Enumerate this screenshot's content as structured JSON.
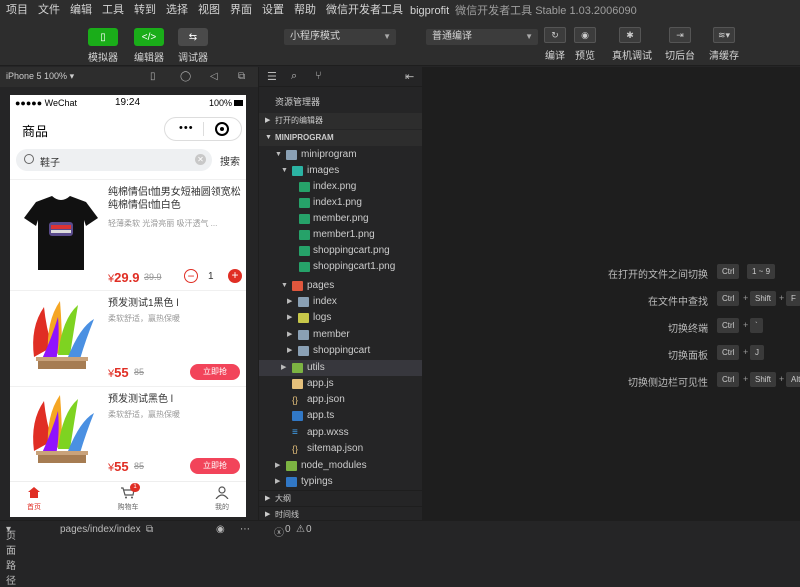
{
  "menubar": {
    "items": [
      "项目",
      "文件",
      "编辑",
      "工具",
      "转到",
      "选择",
      "视图",
      "界面",
      "设置",
      "帮助",
      "微信开发者工具"
    ],
    "project": "bigprofit",
    "app_title": "微信开发者工具 Stable 1.03.2006090"
  },
  "toolbar": {
    "simulator": "模拟器",
    "editor": "编辑器",
    "debugger": "调试器",
    "mode": "小程序模式",
    "compile": "普通编译",
    "compile_label": "编译",
    "preview": "预览",
    "real_debug": "真机调试",
    "background": "切后台",
    "clear_cache": "清缓存"
  },
  "simulator": {
    "device": "iPhone 5 100%",
    "status": {
      "carrier": "●●●●● WeChat",
      "time": "19:24",
      "battery": "100%"
    },
    "nav_title": "商品",
    "capsule_dots": "•••",
    "search_value": "鞋子",
    "search_button": "搜索",
    "products": [
      {
        "name": "纯棉情侣t恤男女短袖圆领宽松纯棉情侣t恤白色",
        "desc": "轻薄柔软 光滑亮丽 吸汗透气 ...",
        "currency": "¥",
        "price": "29.9",
        "orig": "39.9",
        "qty": "1"
      },
      {
        "name": "预发测试1黑色 l",
        "desc": "柔软舒适，赢热保暖",
        "currency": "¥",
        "price": "55",
        "orig": "85",
        "button": "立即抢"
      },
      {
        "name": "预发测试黑色 l",
        "desc": "柔软舒适，赢热保暖",
        "currency": "¥",
        "price": "55",
        "orig": "85",
        "button": "立即抢"
      }
    ],
    "tabs": {
      "home": "首页",
      "cart": "购物车",
      "cart_badge": "1",
      "mine": "我的"
    },
    "footer": {
      "path_label": "页面路径",
      "path": "pages/index/index"
    }
  },
  "explorer": {
    "title": "资源管理器",
    "open_editors": "打开的编辑器",
    "root": "MINIPROGRAM",
    "tree": {
      "miniprogram": "miniprogram",
      "images": "images",
      "img1": "index.png",
      "img2": "index1.png",
      "img3": "member.png",
      "img4": "member1.png",
      "img5": "shoppingcart.png",
      "img6": "shoppingcart1.png",
      "pages": "pages",
      "p_index": "index",
      "p_logs": "logs",
      "p_member": "member",
      "p_cart": "shoppingcart",
      "utils": "utils",
      "appjs": "app.js",
      "appjson": "app.json",
      "appts": "app.ts",
      "appwxss": "app.wxss",
      "sitemap": "sitemap.json",
      "node_modules": "node_modules",
      "typings": "typings"
    },
    "outline": "大纲",
    "timeline": "时间线",
    "problems": {
      "errors": "0",
      "warnings": "0"
    }
  },
  "editor": {
    "shortcuts": [
      {
        "label": "在打开的文件之间切换",
        "keys": [
          "Ctrl",
          "1 ~ 9"
        ]
      },
      {
        "label": "在文件中查找",
        "keys": [
          "Ctrl",
          "Shift",
          "F"
        ]
      },
      {
        "label": "切换终端",
        "keys": [
          "Ctrl",
          "`"
        ]
      },
      {
        "label": "切换面板",
        "keys": [
          "Ctrl",
          "J"
        ]
      },
      {
        "label": "切换侧边栏可见性",
        "keys": [
          "Ctrl",
          "Shift",
          "Alt"
        ]
      }
    ]
  }
}
